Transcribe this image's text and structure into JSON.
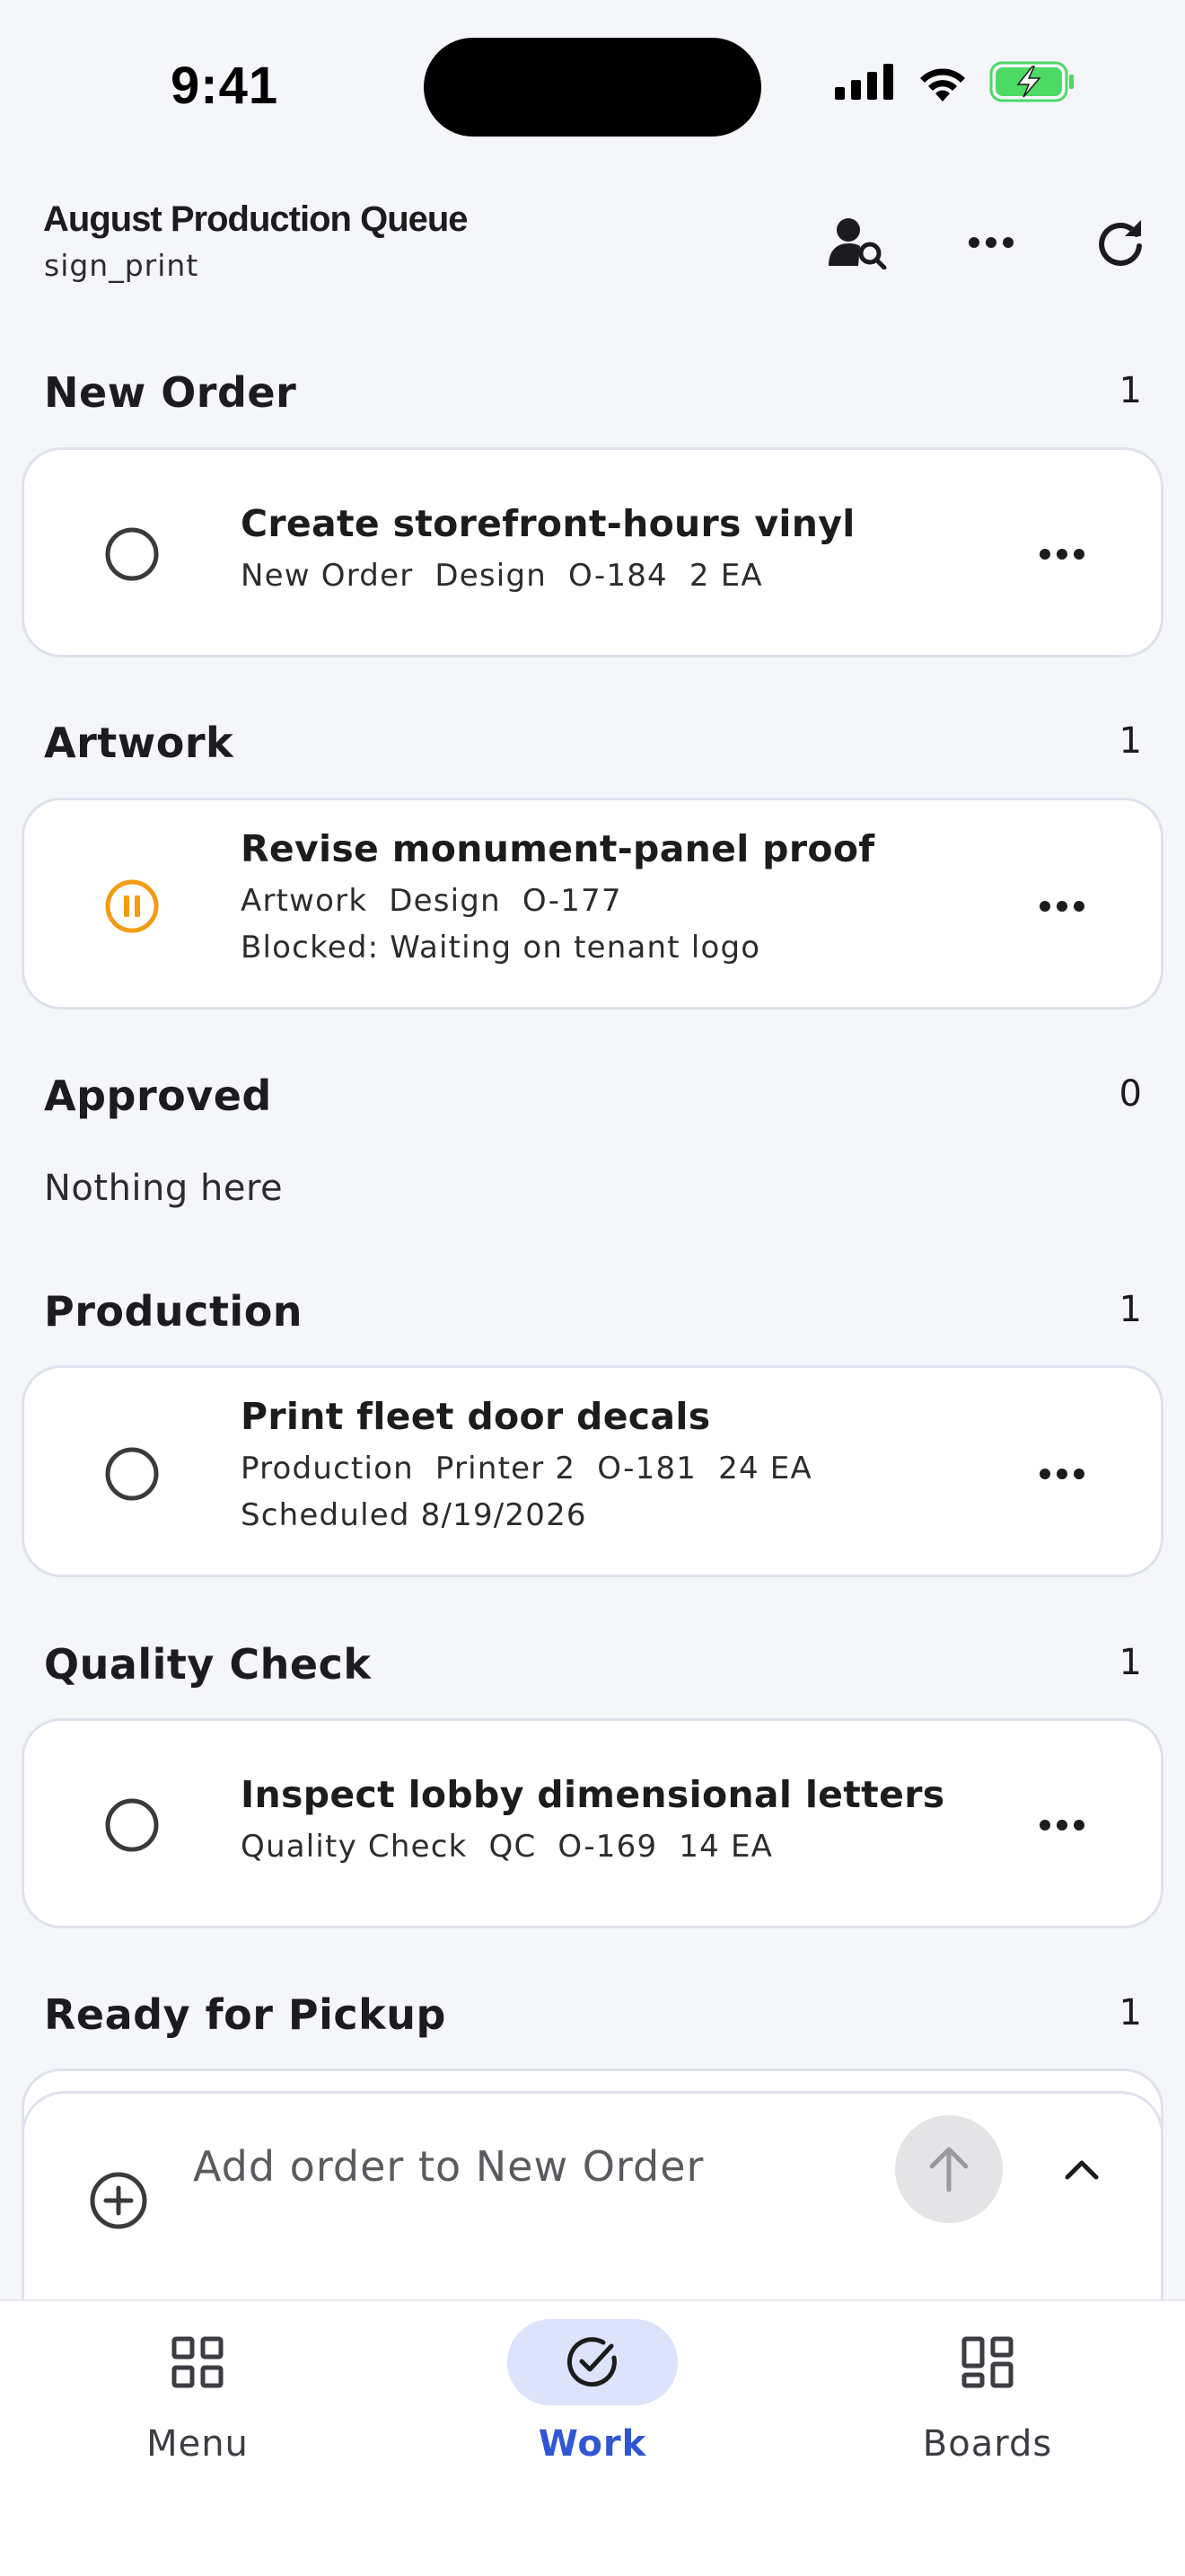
{
  "status_bar": {
    "time": "9:41"
  },
  "header": {
    "title": "August Production Queue",
    "subtitle": "sign_print",
    "actions": [
      "person-search-icon",
      "more-horizontal-icon",
      "refresh-icon"
    ]
  },
  "sections": [
    {
      "title": "New Order",
      "count": "1",
      "cards": [
        {
          "title": "Create storefront-hours vinyl",
          "status_icon": "circle-icon",
          "meta": [
            "New Order",
            "Design",
            "O-184",
            "2 EA"
          ],
          "note": ""
        }
      ]
    },
    {
      "title": "Artwork",
      "count": "1",
      "cards": [
        {
          "title": "Revise monument-panel proof",
          "status_icon": "pause-circle-icon",
          "meta": [
            "Artwork",
            "Design",
            "O-177"
          ],
          "note": "Blocked: Waiting on tenant logo"
        }
      ]
    },
    {
      "title": "Approved",
      "count": "0",
      "empty_text": "Nothing here"
    },
    {
      "title": "Production",
      "count": "1",
      "cards": [
        {
          "title": "Print fleet door decals",
          "status_icon": "circle-icon",
          "meta": [
            "Production",
            "Printer 2",
            "O-181",
            "24 EA"
          ],
          "note": "Scheduled 8/19/2026"
        }
      ]
    },
    {
      "title": "Quality Check",
      "count": "1",
      "cards": [
        {
          "title": "Inspect lobby dimensional letters",
          "status_icon": "circle-icon",
          "meta": [
            "Quality Check",
            "QC",
            "O-169",
            "14 EA"
          ],
          "note": ""
        }
      ]
    },
    {
      "title": "Ready for Pickup",
      "count": "1"
    }
  ],
  "composer": {
    "placeholder": "Add order to New Order"
  },
  "tabbar": {
    "tabs": [
      {
        "label": "Menu",
        "icon": "grid-icon",
        "active": false
      },
      {
        "label": "Work",
        "icon": "check-circle-icon",
        "active": true
      },
      {
        "label": "Boards",
        "icon": "boards-icon",
        "active": false
      }
    ]
  },
  "colors": {
    "accent": "#2f56d3",
    "accent_soft": "#dde3fb",
    "paused": "#f39c12",
    "background": "#f5f6fa",
    "card_border": "#dfe2ec"
  }
}
